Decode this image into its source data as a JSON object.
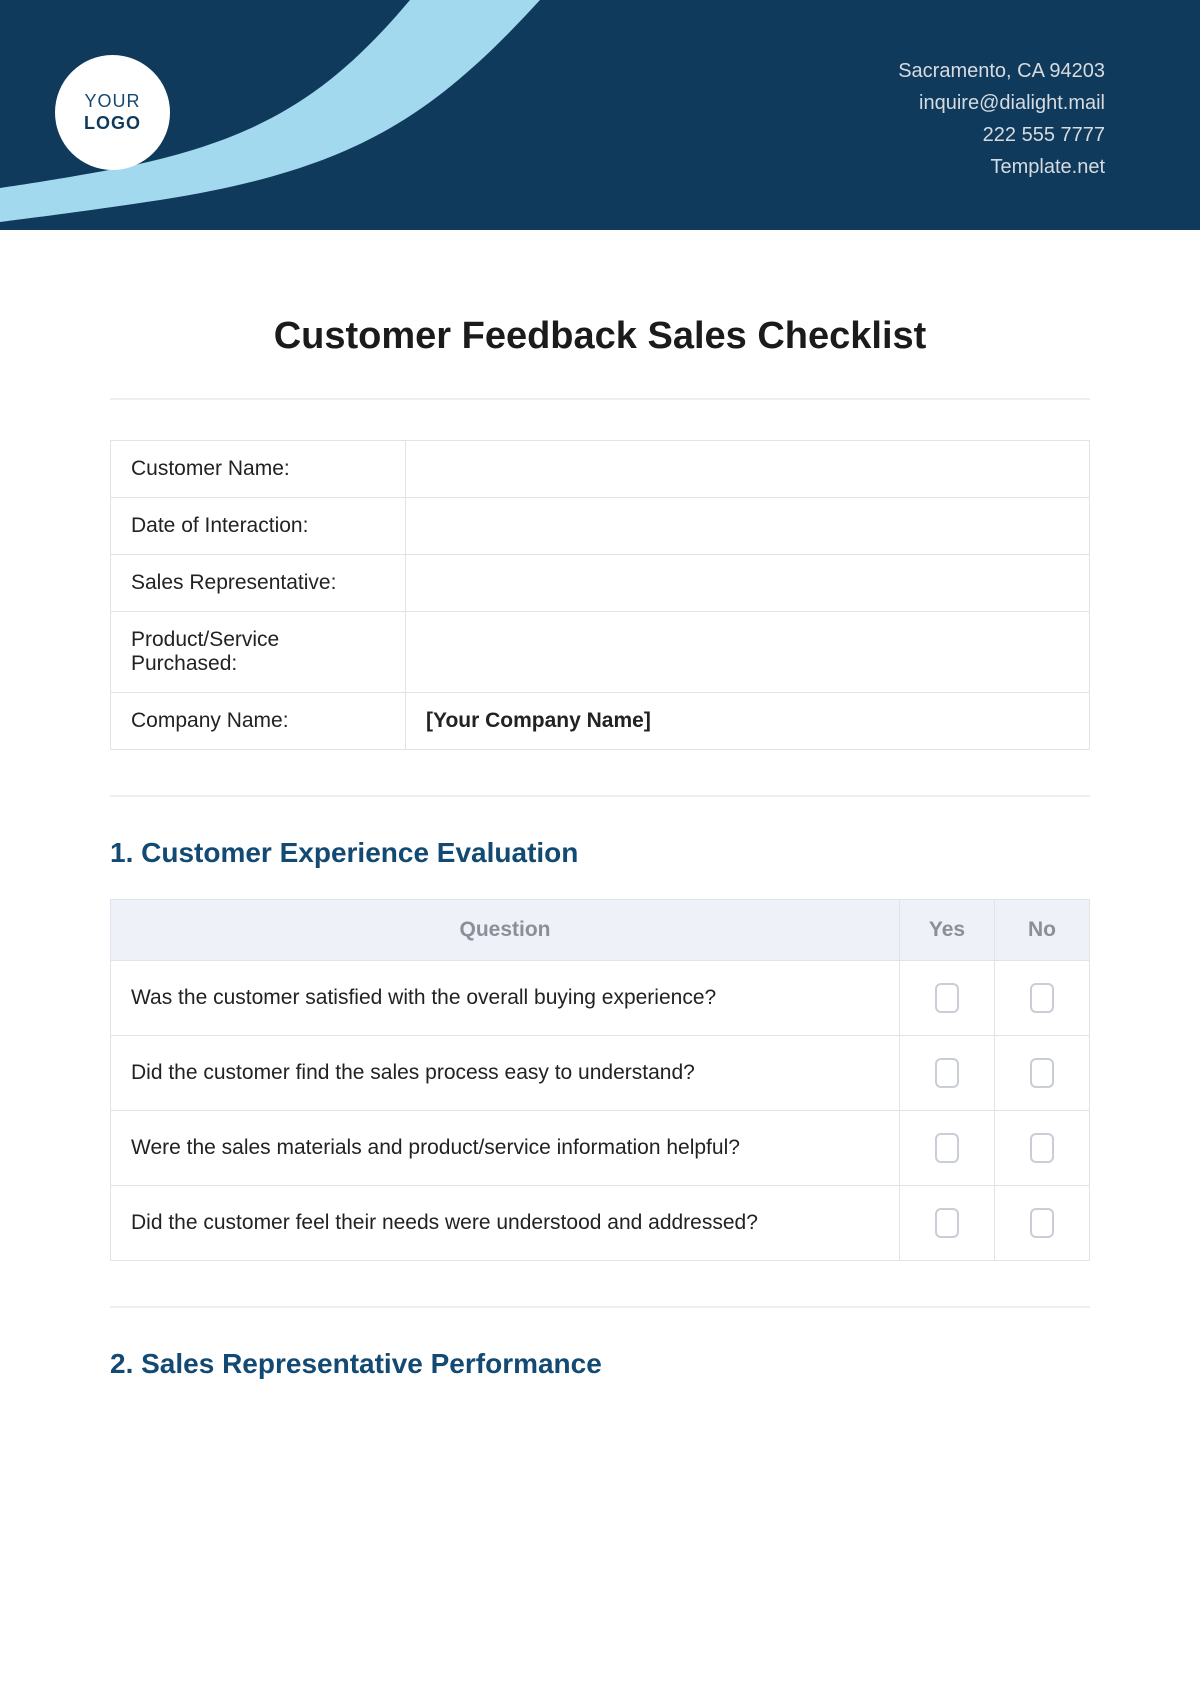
{
  "header": {
    "logo_line1": "YOUR",
    "logo_line2": "LOGO",
    "contact": {
      "address": "Sacramento, CA 94203",
      "email": "inquire@dialight.mail",
      "phone": "222 555 7777",
      "site": "Template.net"
    }
  },
  "title": "Customer Feedback Sales Checklist",
  "info_rows": [
    {
      "label": "Customer Name:",
      "value": ""
    },
    {
      "label": "Date of Interaction:",
      "value": ""
    },
    {
      "label": "Sales Representative:",
      "value": ""
    },
    {
      "label": "Product/Service Purchased:",
      "value": ""
    },
    {
      "label": "Company Name:",
      "value": "[Your Company Name]"
    }
  ],
  "sections": [
    {
      "heading": "1. Customer Experience Evaluation",
      "columns": {
        "question": "Question",
        "yes": "Yes",
        "no": "No"
      },
      "questions": [
        "Was the customer satisfied with the overall buying experience?",
        "Did the customer find the sales process easy to understand?",
        "Were the sales materials and product/service information helpful?",
        "Did the customer feel their needs were understood and addressed?"
      ]
    },
    {
      "heading": "2. Sales Representative Performance"
    }
  ]
}
